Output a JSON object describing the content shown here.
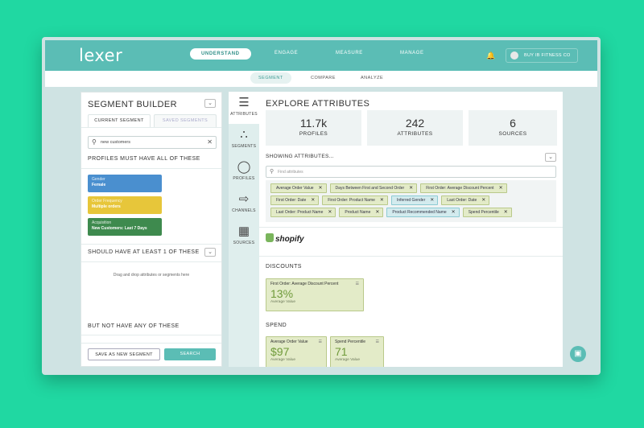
{
  "app": {
    "logo": "lexer"
  },
  "nav": {
    "understand": "UNDERSTAND",
    "engage": "ENGAGE",
    "measure": "MEASURE",
    "manage": "MANAGE"
  },
  "header": {
    "org": "BUY IB FITNESS CO"
  },
  "subnav": {
    "segment": "SEGMENT",
    "compare": "COMPARE",
    "analyze": "ANALYZE"
  },
  "builder": {
    "title": "SEGMENT BUILDER",
    "tab_current": "CURRENT SEGMENT",
    "tab_saved": "SAVED SEGMENTS",
    "search_value": "new customers",
    "must_header": "PROFILES MUST HAVE ALL OF THESE",
    "must_items": [
      {
        "name": "Gender",
        "value": "Female",
        "color": "#4a8fcf"
      },
      {
        "name": "Order Frequency",
        "value": "Multiple orders",
        "color": "#e7c63a"
      },
      {
        "name": "Acquisition",
        "value": "New Customers: Last 7 Days",
        "color": "#3e8a4e"
      }
    ],
    "should_header": "SHOULD HAVE AT LEAST 1 OF THESE",
    "drop_hint": "Drag and drop attributes or segments here",
    "not_header": "BUT NOT HAVE ANY OF THESE",
    "save_label": "SAVE AS NEW SEGMENT",
    "search_label": "SEARCH"
  },
  "sidenav": {
    "attributes": "ATTRIBUTES",
    "segments": "SEGMENTS",
    "profiles": "PROFILES",
    "channels": "CHANNELS",
    "sources": "SOURCES"
  },
  "explore": {
    "title": "EXPLORE ATTRIBUTES",
    "stats": [
      {
        "value": "11.7k",
        "label": "PROFILES"
      },
      {
        "value": "242",
        "label": "ATTRIBUTES"
      },
      {
        "value": "6",
        "label": "SOURCES"
      }
    ],
    "showing": "SHOWING ATTRIBUTES...",
    "find_placeholder": "Find attributes",
    "chips": [
      {
        "label": "Average Order Value",
        "kind": "g"
      },
      {
        "label": "Days Between First and Second Order",
        "kind": "g"
      },
      {
        "label": "First Order: Average Discount Percent",
        "kind": "g"
      },
      {
        "label": "First Order: Date",
        "kind": "g"
      },
      {
        "label": "First Order: Product Name",
        "kind": "g"
      },
      {
        "label": "Inferred Gender",
        "kind": "b"
      },
      {
        "label": "Last Order: Date",
        "kind": "g"
      },
      {
        "label": "Last Order: Product Name",
        "kind": "g"
      },
      {
        "label": "Product Name",
        "kind": "g"
      },
      {
        "label": "Product Recommended Name",
        "kind": "b"
      },
      {
        "label": "Spend Percentile",
        "kind": "g"
      }
    ],
    "source_name": "shopify",
    "discounts_header": "DISCOUNTS",
    "discount_card": {
      "name": "First Order: Average Discount Percent",
      "value": "13%",
      "sub": "Average Value"
    },
    "spend_header": "SPEND",
    "spend_cards": [
      {
        "name": "Average Order Value",
        "value": "$97",
        "sub": "Average Value"
      },
      {
        "name": "Spend Percentile",
        "value": "71",
        "sub": "Average Value"
      }
    ]
  }
}
